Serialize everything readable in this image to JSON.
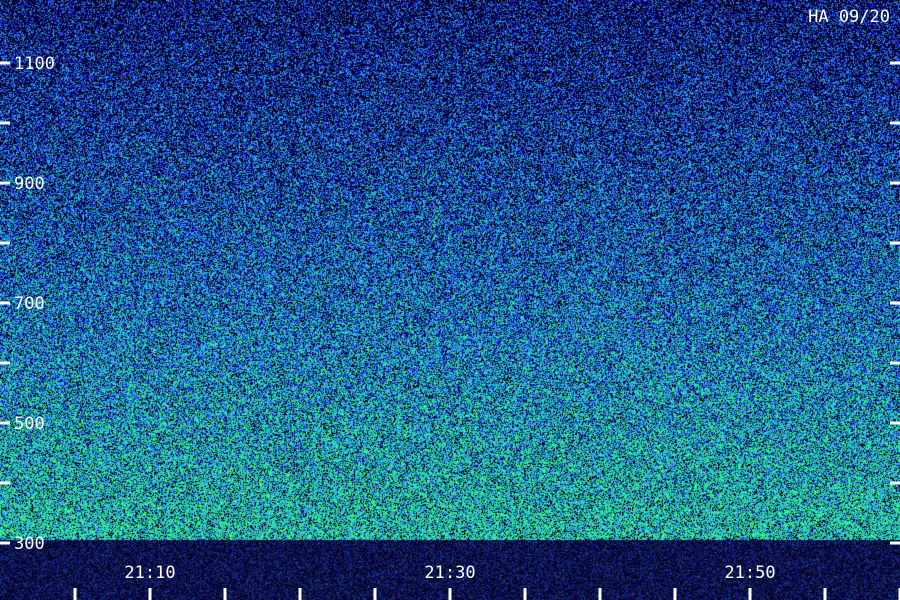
{
  "chart_data": {
    "type": "heatmap",
    "title": "HA 09/20",
    "x_ticks": [
      "21:10",
      "21:30",
      "21:50"
    ],
    "y_ticks": [
      "300",
      "500",
      "700",
      "900",
      "1100"
    ],
    "y_range": [
      300,
      1200
    ],
    "colormap": [
      "#000020",
      "#1a1ad6",
      "#2f6df0",
      "#27b4e8",
      "#20e0a0",
      "#3cff78"
    ],
    "grid": false
  }
}
